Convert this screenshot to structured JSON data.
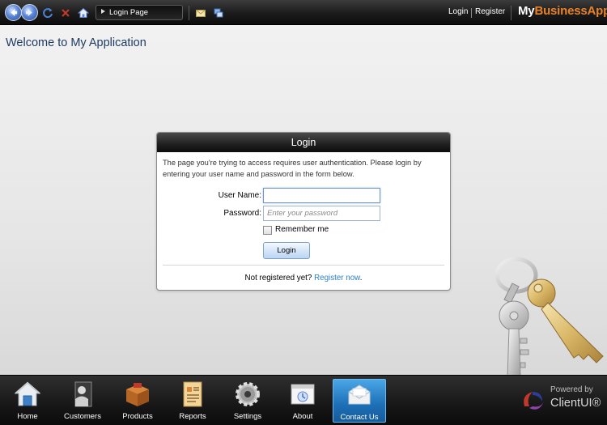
{
  "topbar": {
    "address": "Login Page",
    "links": {
      "login": "Login",
      "register": "Register"
    },
    "brand": {
      "part1": "My",
      "part2": "BusinessApp"
    }
  },
  "page": {
    "title": "Welcome to My Application"
  },
  "login_panel": {
    "title": "Login",
    "description": "The page you're trying to access requires user authentication. Please login by entering your user name and password in the form below.",
    "username_label": "User Name:",
    "username_value": "",
    "password_label": "Password:",
    "password_placeholder": "Enter your password",
    "remember_label": "Remember me",
    "remember_checked": false,
    "login_button": "Login",
    "not_registered": "Not registered yet?",
    "register_link": "Register now",
    "register_suffix": "."
  },
  "dock": {
    "items": [
      {
        "label": "Home",
        "icon": "home-icon"
      },
      {
        "label": "Customers",
        "icon": "customers-icon"
      },
      {
        "label": "Products",
        "icon": "products-icon"
      },
      {
        "label": "Reports",
        "icon": "reports-icon"
      },
      {
        "label": "Settings",
        "icon": "settings-icon"
      },
      {
        "label": "About",
        "icon": "about-icon"
      },
      {
        "label": "Contact Us",
        "icon": "contact-icon",
        "active": true
      }
    ]
  },
  "powered_by": {
    "line1": "Powered by",
    "line2": "ClientUI®"
  },
  "colors": {
    "brand_accent": "#e8822a",
    "link": "#2d7fc8",
    "active_tab": "#1d6fb6"
  }
}
